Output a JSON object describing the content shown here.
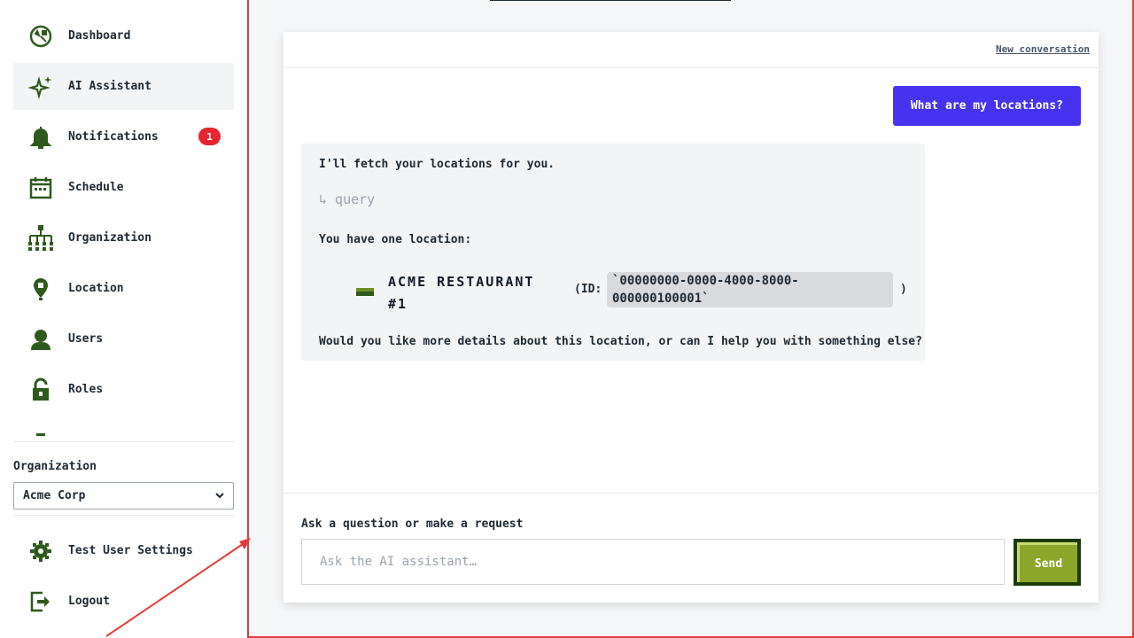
{
  "sidebar": {
    "items": [
      {
        "label": "Dashboard",
        "icon": "dashboard-icon"
      },
      {
        "label": "AI Assistant",
        "icon": "sparkle-icon",
        "active": true
      },
      {
        "label": "Notifications",
        "icon": "bell-icon",
        "badge": "1"
      },
      {
        "label": "Schedule",
        "icon": "calendar-icon"
      },
      {
        "label": "Organization",
        "icon": "org-chart-icon"
      },
      {
        "label": "Location",
        "icon": "location-pin-icon"
      },
      {
        "label": "Users",
        "icon": "user-icon"
      },
      {
        "label": "Roles",
        "icon": "lock-icon"
      }
    ],
    "organization_label": "Organization",
    "organization_selected": "Acme Corp",
    "bottom_items": [
      {
        "label": "Test User Settings",
        "icon": "gear-icon"
      },
      {
        "label": "Logout",
        "icon": "logout-icon"
      }
    ]
  },
  "chat": {
    "new_conversation": "New conversation",
    "user_message": "What are my locations?",
    "assistant": {
      "intro": "I'll fetch your locations for you.",
      "tool_call": "↳ query",
      "summary": "You have one location:",
      "location_name": "ACME RESTAURANT #1",
      "id_open": "(ID:",
      "location_id": "`00000000-0000-4000-8000-000000100001`",
      "id_close": ")",
      "followup": "Would you like more details about this location, or can I help you with something else?"
    },
    "composer_label": "Ask a question or make a request",
    "composer_placeholder": "Ask the AI assistant…",
    "send_label": "Send"
  },
  "colors": {
    "icon_green": "#2e5a1c",
    "accent_purple": "#4633f0",
    "badge_red": "#e5252f",
    "send_green": "#8ca62a",
    "frame_red": "#e23b3b"
  }
}
